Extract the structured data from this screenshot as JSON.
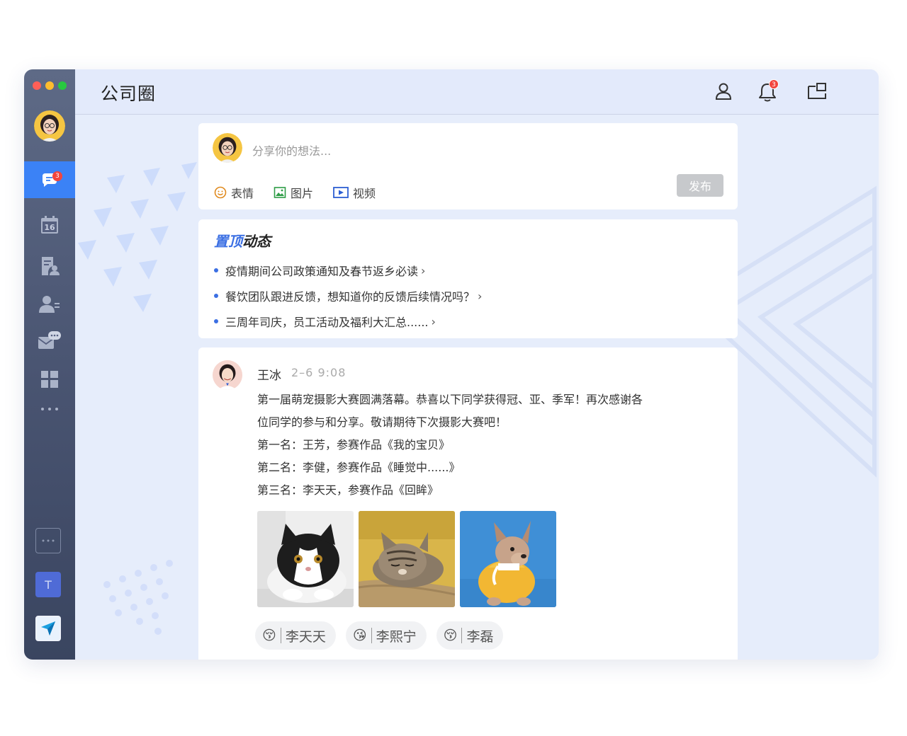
{
  "app": {
    "title": "公司圈"
  },
  "sidebar": {
    "chat_badge": "3",
    "calendar_day": "16",
    "tile_letter": "T"
  },
  "header": {
    "notification_badge": "3"
  },
  "composer": {
    "placeholder": "分享你的想法...",
    "tools": [
      {
        "label": "表情",
        "icon": "emoji-icon"
      },
      {
        "label": "图片",
        "icon": "image-icon"
      },
      {
        "label": "视频",
        "icon": "video-icon"
      }
    ],
    "publish_label": "发布"
  },
  "pinned": {
    "title_accent": "置顶",
    "title_rest": "动态",
    "items": [
      "疫情期间公司政策通知及春节返乡必读",
      "餐饮团队跟进反馈，想知道你的反馈后续情况吗？",
      "三周年司庆，员工活动及福利大汇总......"
    ]
  },
  "post": {
    "author": "王冰",
    "time": "2–6  9:08",
    "lines": [
      "第一届萌宠摄影大赛圆满落幕。恭喜以下同学获得冠、亚、季军！再次感谢各",
      "位同学的参与和分享。敬请期待下次摄影大赛吧！",
      "第一名：王芳，参赛作品《我的宝贝》",
      "第二名：李健，参赛作品《睡觉中......》",
      "第三名：李天天，参赛作品《回眸》"
    ],
    "photos": [
      "cat-photo",
      "sleeping-cat-photo",
      "dog-photo"
    ],
    "reactions": [
      {
        "emoji": "😚",
        "name": "李天天"
      },
      {
        "emoji": "😘",
        "name": "李熙宁"
      },
      {
        "emoji": "😚",
        "name": "李磊"
      }
    ]
  },
  "colors": {
    "accent": "#3b82f6",
    "sidebar": "#4a5572",
    "background": "#e6edfb",
    "badge": "#f2453d"
  }
}
